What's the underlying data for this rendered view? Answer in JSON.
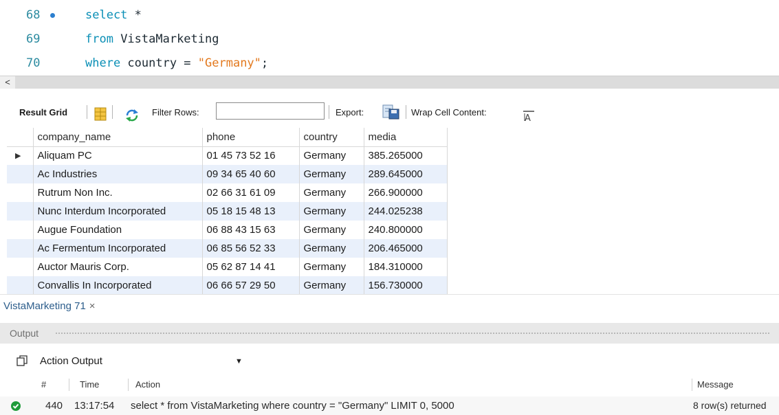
{
  "editor": {
    "lines": [
      {
        "number": "68",
        "keyword": "select",
        "rest": " *",
        "has_dot": true
      },
      {
        "number": "69",
        "keyword": "from",
        "rest": " VistaMarketing",
        "has_dot": false
      },
      {
        "number": "70",
        "keyword": "where",
        "rest": " country = ",
        "string": "\"Germany\"",
        "end": ";",
        "has_dot": false
      }
    ],
    "colors": {
      "keyword": "#0b8fb6",
      "string": "#e3791e",
      "line_number": "#2c8ba0"
    }
  },
  "scrollbar": {
    "left_arrow": "<"
  },
  "toolbar": {
    "result_grid_label": "Result Grid",
    "grid_icon": "grid-layout-icon",
    "refresh_icon": "refresh-icon",
    "filter_label": "Filter Rows:",
    "filter_value": "",
    "export_label": "Export:",
    "export_icon": "export-icon",
    "wrap_label": "Wrap Cell Content:",
    "wrap_icon": "wrap-text-icon"
  },
  "grid": {
    "columns": [
      "company_name",
      "phone",
      "country",
      "media"
    ],
    "rows": [
      [
        "Aliquam PC",
        "01 45 73 52 16",
        "Germany",
        "385.265000"
      ],
      [
        "Ac Industries",
        "09 34 65 40 60",
        "Germany",
        "289.645000"
      ],
      [
        "Rutrum Non Inc.",
        "02 66 31 61 09",
        "Germany",
        "266.900000"
      ],
      [
        "Nunc Interdum Incorporated",
        "05 18 15 48 13",
        "Germany",
        "244.025238"
      ],
      [
        "Augue Foundation",
        "06 88 43 15 63",
        "Germany",
        "240.800000"
      ],
      [
        "Ac Fermentum Incorporated",
        "06 85 56 52 33",
        "Germany",
        "206.465000"
      ],
      [
        "Auctor Mauris Corp.",
        "05 62 87 14 41",
        "Germany",
        "184.310000"
      ],
      [
        "Convallis In Incorporated",
        "06 66 57 29 50",
        "Germany",
        "156.730000"
      ]
    ],
    "current_row_marker": "▶"
  },
  "tab": {
    "label": "VistaMarketing 71",
    "close": "×"
  },
  "output": {
    "title": "Output",
    "selector_value": "Action Output",
    "columns": {
      "num": "#",
      "time": "Time",
      "action": "Action",
      "message": "Message"
    },
    "entries": [
      {
        "num": "440",
        "time": "13:17:54",
        "action": "select * from VistaMarketing where country = \"Germany\" LIMIT 0, 5000",
        "message": "8 row(s) returned",
        "status": "success"
      }
    ]
  }
}
